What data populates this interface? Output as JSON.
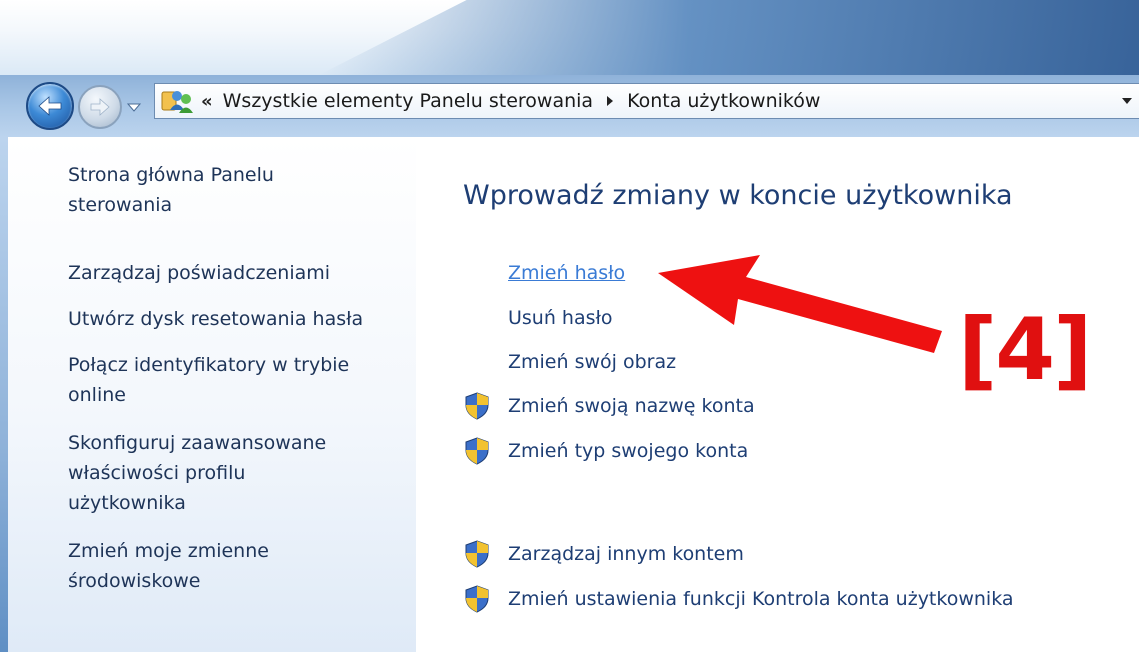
{
  "address_bar": {
    "overflow_chevrons": "«",
    "crumbs": [
      "Wszystkie elementy Panelu sterowania",
      "Konta użytkowników"
    ]
  },
  "sidebar": {
    "items": [
      {
        "label_lines": [
          "Strona główna Panelu",
          "sterowania"
        ]
      },
      {
        "label_lines": [
          "Zarządzaj poświadczeniami"
        ]
      },
      {
        "label_lines": [
          "Utwórz dysk resetowania hasła"
        ]
      },
      {
        "label_lines": [
          "Połącz identyfikatory w trybie",
          "online"
        ]
      },
      {
        "label_lines": [
          "Skonfiguruj zaawansowane",
          "właściwości profilu",
          "użytkownika"
        ]
      },
      {
        "label_lines": [
          "Zmień moje zmienne",
          "środowiskowe"
        ]
      }
    ]
  },
  "main": {
    "title": "Wprowadź zmiany w koncie użytkownika",
    "tasks": [
      {
        "label": "Zmień hasło",
        "shield": false,
        "hover": true
      },
      {
        "label": "Usuń hasło",
        "shield": false
      },
      {
        "label": "Zmień swój obraz",
        "shield": false
      },
      {
        "label": "Zmień swoją nazwę konta",
        "shield": true
      },
      {
        "label": "Zmień typ swojego konta",
        "shield": true
      }
    ],
    "other_tasks": [
      {
        "label": "Zarządzaj innym kontem",
        "shield": true
      },
      {
        "label": "Zmień ustawienia funkcji Kontrola konta użytkownika",
        "shield": true
      }
    ]
  },
  "annotation": {
    "step_label": "[4]",
    "color": "#e01010"
  },
  "icons": {
    "back": "back-arrow-icon",
    "forward": "forward-arrow-icon",
    "address": "users-icon",
    "uac": "uac-shield-icon"
  },
  "colors": {
    "link": "#1e3e74",
    "link_hover": "#3a7bd5",
    "sidebar_link": "#1e3458"
  }
}
